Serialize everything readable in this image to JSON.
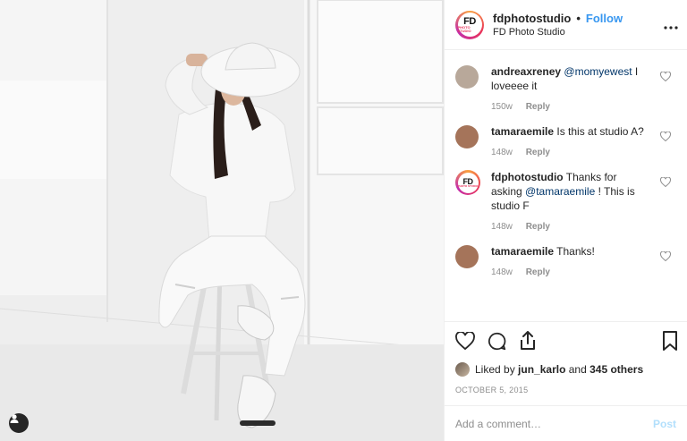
{
  "header": {
    "username": "fdphotostudio",
    "follow_label": "Follow",
    "location": "FD Photo Studio",
    "avatar_text_big": "FD",
    "avatar_text_small": "PHOTO STUDIO",
    "more_label": "•••"
  },
  "comments": [
    {
      "user": "andreaxreney",
      "mention": "@momyewest",
      "text_after": " I loveeee it",
      "age": "150w",
      "reply": "Reply",
      "avatar_color": "#b8a89a"
    },
    {
      "user": "tamaraemile",
      "text": " Is this at studio A?",
      "age": "148w",
      "reply": "Reply",
      "avatar_color": "#a5745a"
    },
    {
      "user": "fdphotostudio",
      "text_before": " Thanks for asking ",
      "mention": "@tamaraemile",
      "text_after": " ! This is studio F",
      "age": "148w",
      "reply": "Reply"
    },
    {
      "user": "tamaraemile",
      "text": " Thanks!",
      "age": "148w",
      "reply": "Reply",
      "avatar_color": "#a5745a"
    }
  ],
  "likes": {
    "prefix": "Liked by",
    "user": "jun_karlo",
    "middle": "and",
    "others": "345 others"
  },
  "date": "OCTOBER 5, 2015",
  "add_comment": {
    "placeholder": "Add a comment…",
    "post_label": "Post"
  },
  "colors": {
    "accent": "#3897f0",
    "post_disabled": "#b2dffc",
    "meta_gray": "#8e8e8e"
  },
  "icons": [
    "heart-icon",
    "comment-icon",
    "share-icon",
    "bookmark-icon",
    "user-tag-icon",
    "more-icon"
  ]
}
